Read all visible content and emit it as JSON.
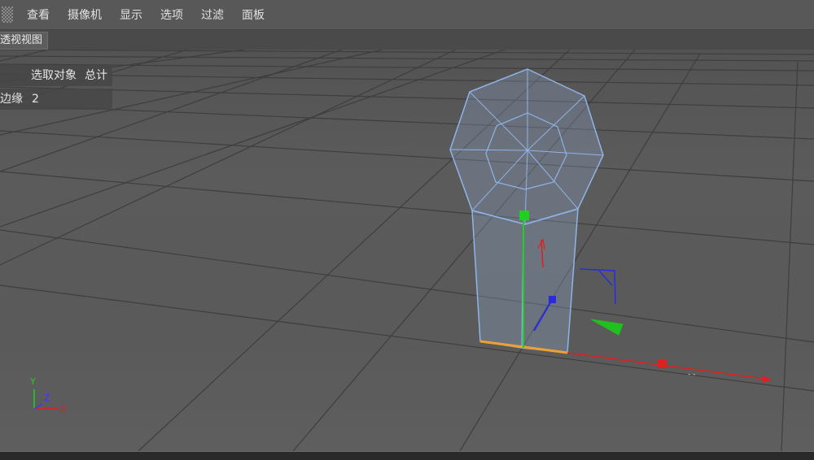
{
  "menubar": {
    "items": [
      "查看",
      "摄像机",
      "显示",
      "选项",
      "过滤",
      "面板"
    ]
  },
  "viewport": {
    "tab_label": "透视视图",
    "hud": {
      "selection_label": "选取对象",
      "selection_value": "总计",
      "edges_label": "边缘",
      "edges_value": "2"
    },
    "axis_gizmo": {
      "y": "Y",
      "z": "Z",
      "x": "X"
    }
  },
  "colors": {
    "x_axis": "#e02020",
    "y_axis": "#20d020",
    "z_axis": "#2a2adf",
    "mesh_wire": "#8fb4e8",
    "selected_edge": "#f0a030"
  }
}
